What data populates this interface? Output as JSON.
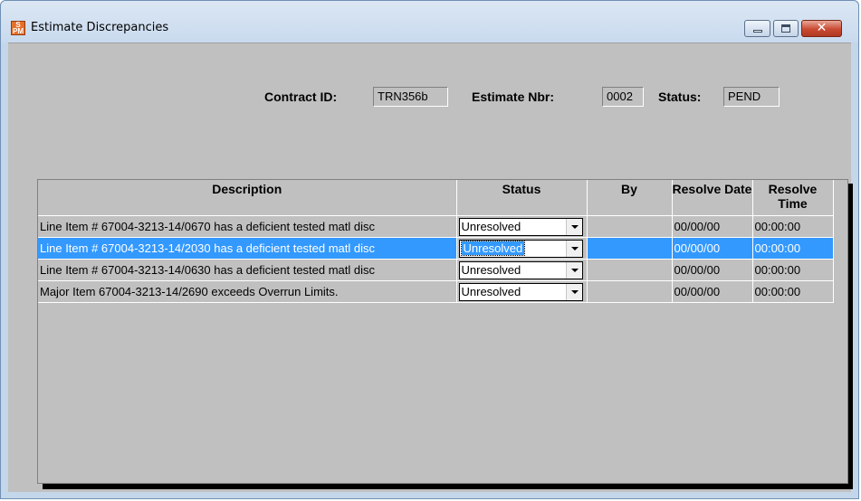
{
  "window": {
    "title": "Estimate Discrepancies",
    "icon_letters": [
      "P",
      "S",
      "M"
    ]
  },
  "header": {
    "contract_id_label": "Contract ID:",
    "contract_id_value": "TRN356b",
    "estimate_nbr_label": "Estimate Nbr:",
    "estimate_nbr_value": "0002",
    "status_label": "Status:",
    "status_value": "PEND"
  },
  "grid": {
    "columns": [
      "Description",
      "Status",
      "By",
      "Resolve Date",
      "Resolve Time"
    ],
    "rows": [
      {
        "description": "Line Item # 67004-3213-14/0670 has a deficient tested matl disc",
        "status": "Unresolved",
        "by": "",
        "resolve_date": "00/00/00",
        "resolve_time": "00:00:00"
      },
      {
        "description": "Line Item # 67004-3213-14/2030 has a deficient tested matl disc",
        "status": "Unresolved",
        "by": "",
        "resolve_date": "00/00/00",
        "resolve_time": "00:00:00"
      },
      {
        "description": "Line Item # 67004-3213-14/0630 has a deficient tested matl disc",
        "status": "Unresolved",
        "by": "",
        "resolve_date": "00/00/00",
        "resolve_time": "00:00:00"
      },
      {
        "description": "Major Item 67004-3213-14/2690 exceeds Overrun Limits.",
        "status": "Unresolved",
        "by": "",
        "resolve_date": "00/00/00",
        "resolve_time": "00:00:00"
      }
    ],
    "selected_row": 1
  },
  "colors": {
    "selection": "#3399ff",
    "client_background": "#c0c0c0",
    "close_button": "#c94a32"
  },
  "icons": {
    "app": "psm-app-icon",
    "minimize": "minimize-icon",
    "maximize": "maximize-icon",
    "close": "close-icon",
    "dropdown": "chevron-down-icon"
  }
}
